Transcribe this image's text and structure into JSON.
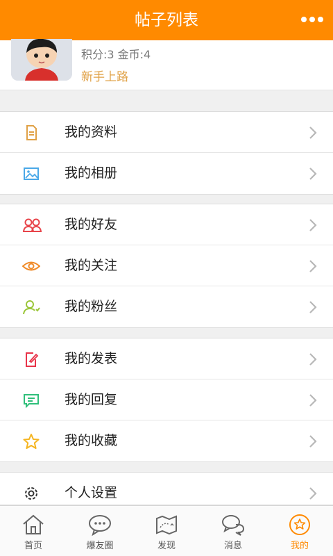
{
  "header": {
    "title": "帖子列表",
    "more_icon": "more-dots-icon"
  },
  "profile": {
    "points_text": "积分:3 金币:4",
    "level": "新手上路"
  },
  "groups": [
    [
      {
        "label": "我的资料",
        "icon": "document-icon"
      },
      {
        "label": "我的相册",
        "icon": "picture-icon"
      }
    ],
    [
      {
        "label": "我的好友",
        "icon": "friends-icon"
      },
      {
        "label": "我的关注",
        "icon": "eye-icon"
      },
      {
        "label": "我的粉丝",
        "icon": "fans-icon"
      }
    ],
    [
      {
        "label": "我的发表",
        "icon": "edit-icon"
      },
      {
        "label": "我的回复",
        "icon": "reply-icon"
      },
      {
        "label": "我的收藏",
        "icon": "star-icon"
      }
    ],
    [
      {
        "label": "个人设置",
        "icon": "gear-icon"
      }
    ]
  ],
  "tabs": [
    {
      "label": "首页",
      "icon": "home-icon"
    },
    {
      "label": "爆友圈",
      "icon": "chat-bubble-icon"
    },
    {
      "label": "发现",
      "icon": "map-icon"
    },
    {
      "label": "消息",
      "icon": "messages-icon"
    },
    {
      "label": "我的",
      "icon": "star-circle-icon",
      "active": true
    }
  ],
  "colors": {
    "accent": "#ff8a00",
    "level": "#e0a146"
  }
}
